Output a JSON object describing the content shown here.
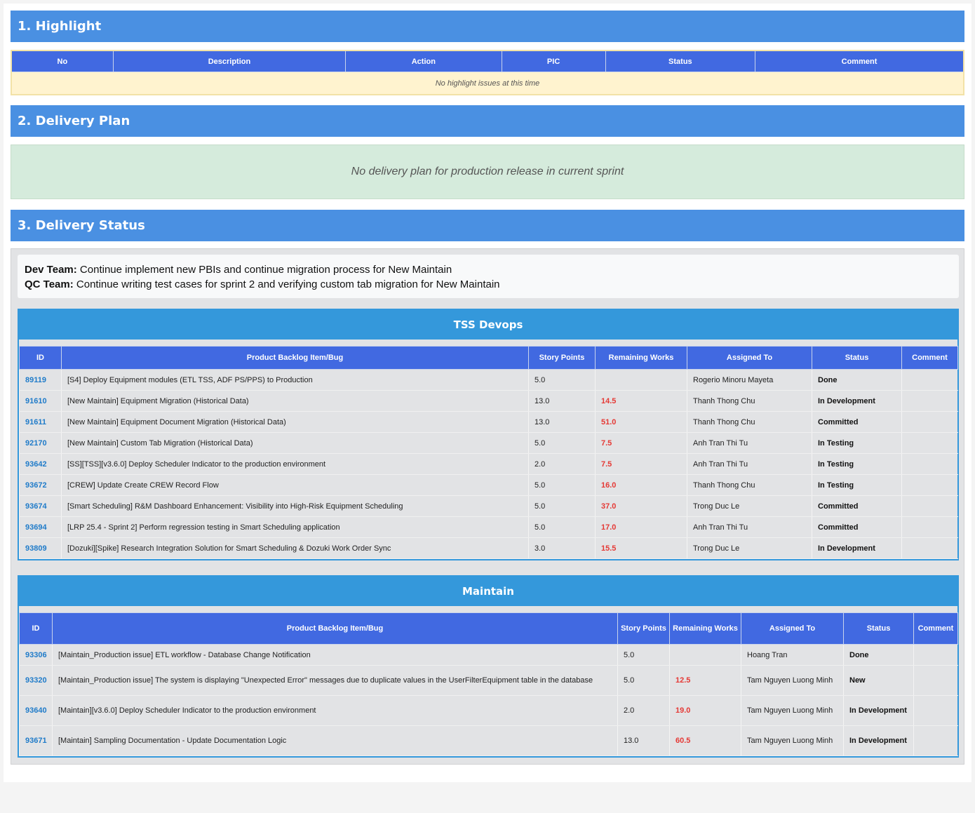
{
  "sections": {
    "highlight_title": "1. Highlight",
    "delivery_plan_title": "2. Delivery Plan",
    "delivery_status_title": "3. Delivery Status"
  },
  "highlight": {
    "columns": [
      "No",
      "Description",
      "Action",
      "PIC",
      "Status",
      "Comment"
    ],
    "empty_message": "No highlight issues at this time"
  },
  "delivery_plan": {
    "message": "No delivery plan for production release in current sprint"
  },
  "delivery_status": {
    "dev_team_label": "Dev Team:",
    "dev_team_text": " Continue implement new PBIs and continue migration process for New Maintain",
    "qc_team_label": "QC Team:",
    "qc_team_text": " Continue writing test cases for sprint 2 and verifying custom tab migration for New Maintain"
  },
  "tss": {
    "title": "TSS Devops",
    "columns": [
      "ID",
      "Product Backlog Item/Bug",
      "Story Points",
      "Remaining Works",
      "Assigned To",
      "Status",
      "Comment"
    ],
    "rows": [
      {
        "id": "89119",
        "item": "[S4] Deploy Equipment modules (ETL TSS, ADF PS/PPS) to Production",
        "points": "5.0",
        "remaining": "",
        "assigned": "Rogerio Minoru Mayeta",
        "status": "Done",
        "comment": ""
      },
      {
        "id": "91610",
        "item": "[New Maintain] Equipment Migration (Historical Data)",
        "points": "13.0",
        "remaining": "14.5",
        "assigned": "Thanh Thong Chu",
        "status": "In Development",
        "comment": ""
      },
      {
        "id": "91611",
        "item": "[New Maintain] Equipment Document Migration (Historical Data)",
        "points": "13.0",
        "remaining": "51.0",
        "assigned": "Thanh Thong Chu",
        "status": "Committed",
        "comment": ""
      },
      {
        "id": "92170",
        "item": "[New Maintain] Custom Tab Migration (Historical Data)",
        "points": "5.0",
        "remaining": "7.5",
        "assigned": "Anh Tran Thi Tu",
        "status": "In Testing",
        "comment": ""
      },
      {
        "id": "93642",
        "item": "[SS][TSS][v3.6.0] Deploy Scheduler Indicator to the production environment",
        "points": "2.0",
        "remaining": "7.5",
        "assigned": "Anh Tran Thi Tu",
        "status": "In Testing",
        "comment": ""
      },
      {
        "id": "93672",
        "item": "[CREW] Update Create CREW Record Flow",
        "points": "5.0",
        "remaining": "16.0",
        "assigned": "Thanh Thong Chu",
        "status": "In Testing",
        "comment": ""
      },
      {
        "id": "93674",
        "item": "[Smart Scheduling] R&M Dashboard Enhancement: Visibility into High-Risk Equipment Scheduling",
        "points": "5.0",
        "remaining": "37.0",
        "assigned": "Trong Duc Le",
        "status": "Committed",
        "comment": ""
      },
      {
        "id": "93694",
        "item": "[LRP 25.4 - Sprint 2] Perform regression testing in Smart Scheduling application",
        "points": "5.0",
        "remaining": "17.0",
        "assigned": "Anh Tran Thi Tu",
        "status": "Committed",
        "comment": ""
      },
      {
        "id": "93809",
        "item": "[Dozuki][Spike] Research Integration Solution for Smart Scheduling & Dozuki Work Order Sync",
        "points": "3.0",
        "remaining": "15.5",
        "assigned": "Trong Duc Le",
        "status": "In Development",
        "comment": ""
      }
    ]
  },
  "maintain": {
    "title": "Maintain",
    "columns": [
      "ID",
      "Product Backlog Item/Bug",
      "Story Points",
      "Remaining Works",
      "Assigned To",
      "Status",
      "Comment"
    ],
    "rows": [
      {
        "id": "93306",
        "item": "[Maintain_Production issue] ETL workflow - Database Change Notification",
        "points": "5.0",
        "remaining": "",
        "assigned": "Hoang Tran",
        "status": "Done",
        "comment": ""
      },
      {
        "id": "93320",
        "item": "[Maintain_Production issue] The system is displaying \"Unexpected Error\" messages due to duplicate values in the UserFilterEquipment table in the database",
        "points": "5.0",
        "remaining": "12.5",
        "assigned": "Tam Nguyen Luong Minh",
        "status": "New",
        "comment": ""
      },
      {
        "id": "93640",
        "item": "[Maintain][v3.6.0] Deploy Scheduler Indicator to the production environment",
        "points": "2.0",
        "remaining": "19.0",
        "assigned": "Tam Nguyen Luong Minh",
        "status": "In Development",
        "comment": ""
      },
      {
        "id": "93671",
        "item": "[Maintain] Sampling Documentation - Update Documentation Logic",
        "points": "13.0",
        "remaining": "60.5",
        "assigned": "Tam Nguyen Luong Minh",
        "status": "In Development",
        "comment": ""
      }
    ]
  }
}
